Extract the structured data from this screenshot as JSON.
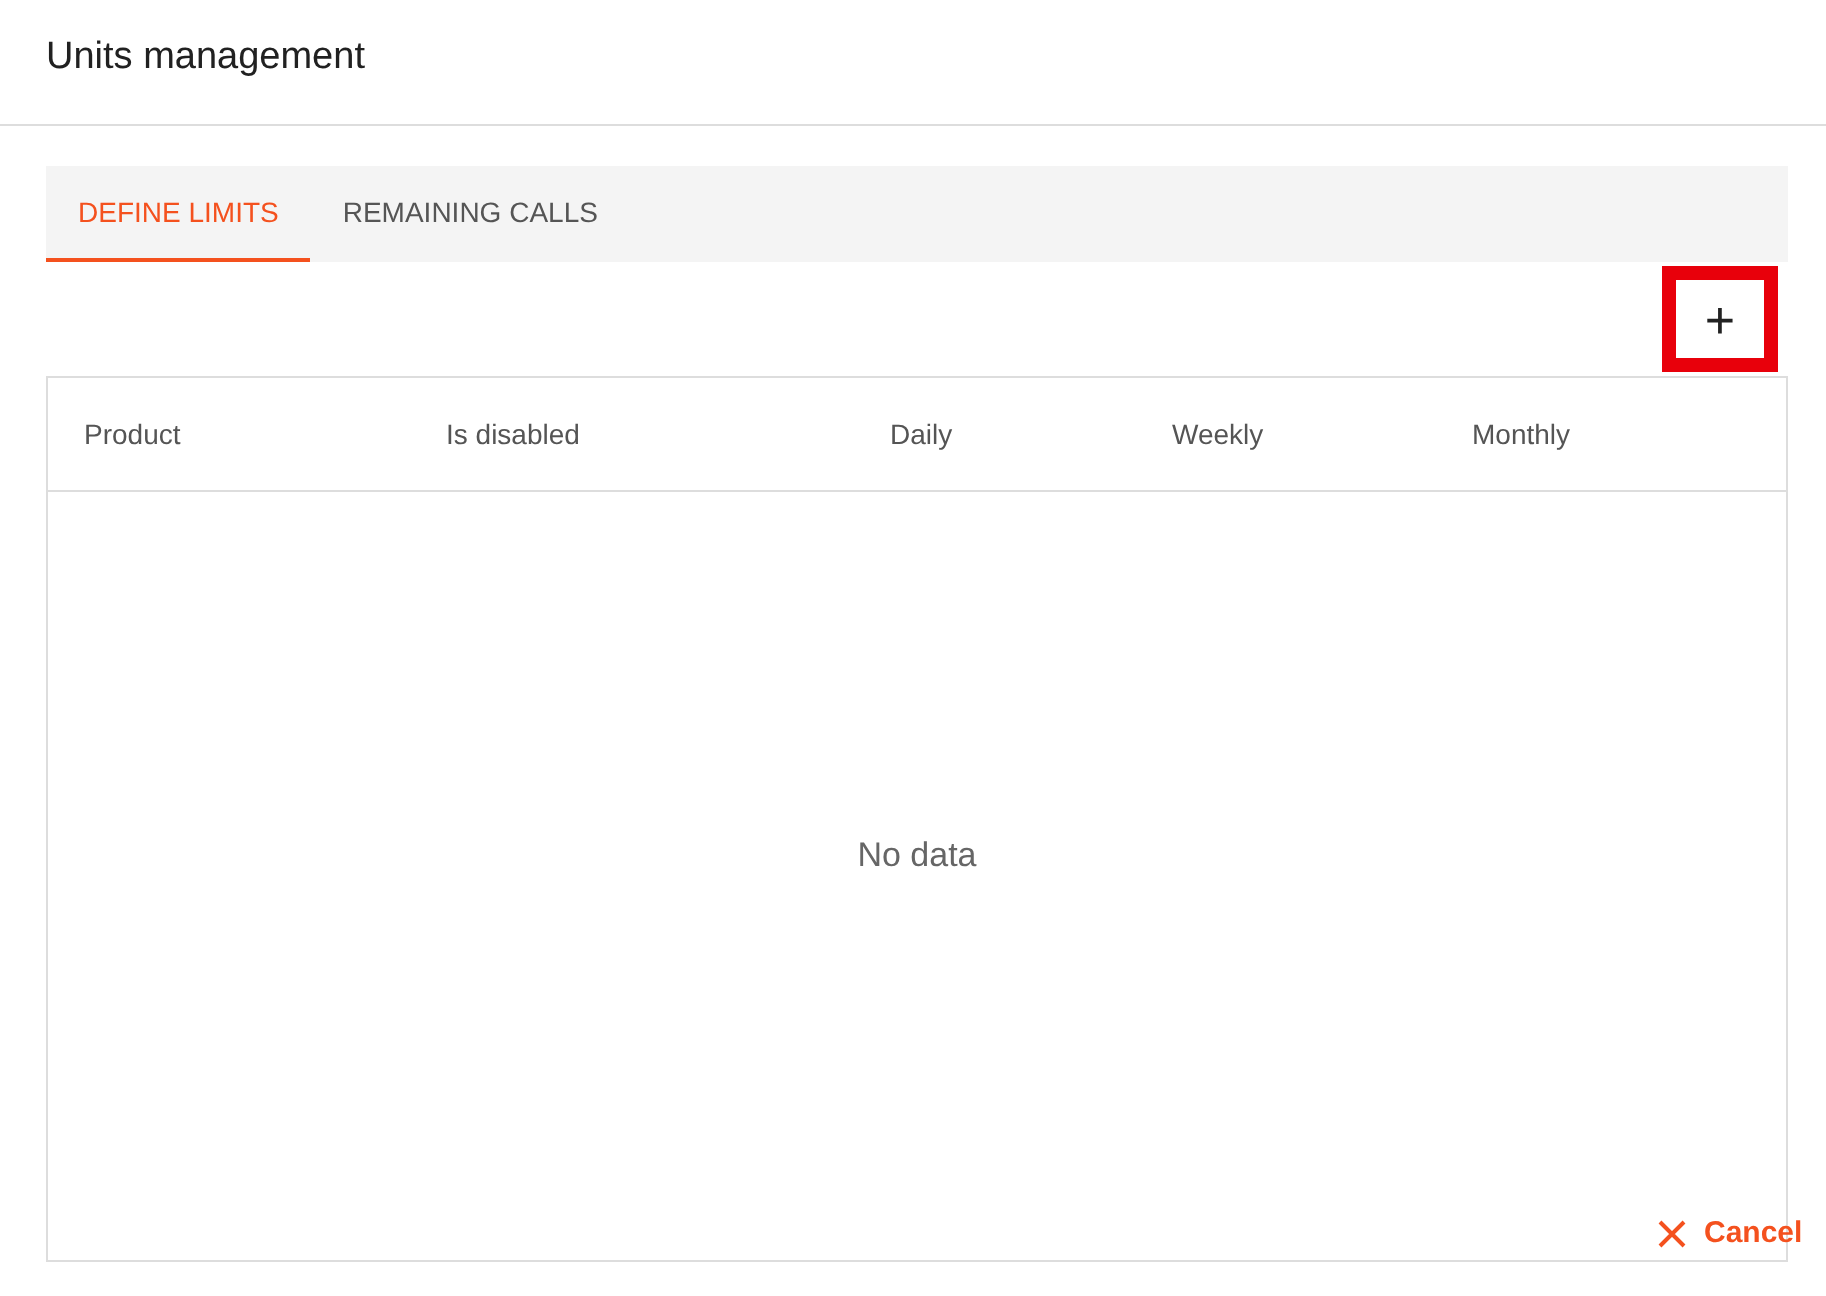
{
  "window": {
    "title": "Units management"
  },
  "tabs": [
    {
      "label": "DEFINE LIMITS",
      "selected": true
    },
    {
      "label": "REMAINING CALLS",
      "selected": false
    }
  ],
  "add_button": {
    "label": "+",
    "highlighted": true
  },
  "table": {
    "columns": [
      "Product",
      "Is disabled",
      "Daily",
      "Weekly",
      "Monthly"
    ],
    "empty_text": "No data"
  },
  "cancel_button": {
    "label": "Cancel"
  }
}
